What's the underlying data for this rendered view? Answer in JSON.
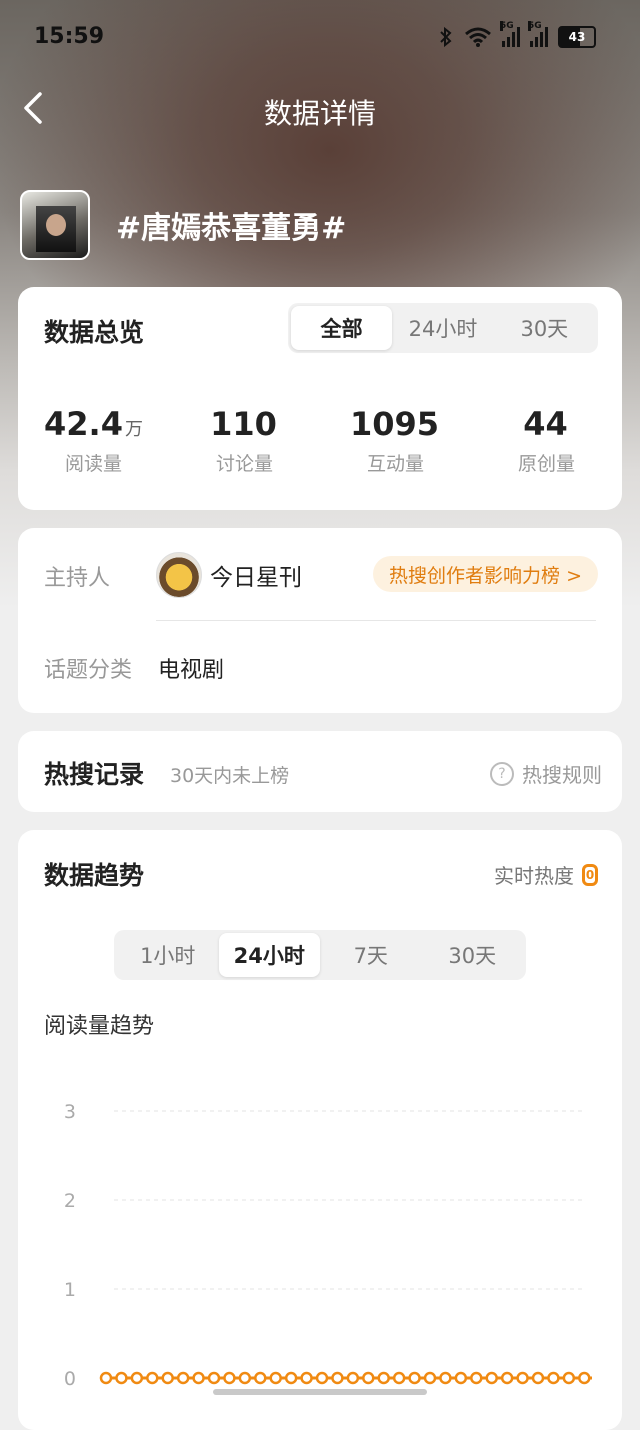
{
  "status": {
    "time": "15:59",
    "net1": "5G",
    "net2": "5G",
    "battery": "43"
  },
  "nav": {
    "title": "数据详情"
  },
  "topic": {
    "title": "#唐嫣恭喜董勇#"
  },
  "overview": {
    "title": "数据总览",
    "ranges": [
      "全部",
      "24小时",
      "30天"
    ],
    "selected_range": "全部",
    "stats": [
      {
        "value": "42.4",
        "unit": "万",
        "label": "阅读量"
      },
      {
        "value": "110",
        "unit": "",
        "label": "讨论量"
      },
      {
        "value": "1095",
        "unit": "",
        "label": "互动量"
      },
      {
        "value": "44",
        "unit": "",
        "label": "原创量"
      }
    ]
  },
  "info": {
    "host_label": "主持人",
    "host_name": "今日星刊",
    "rank_link": "热搜创作者影响力榜 >",
    "category_label": "话题分类",
    "category_value": "电视剧"
  },
  "hot": {
    "title": "热搜记录",
    "subtitle": "30天内未上榜",
    "rule": "热搜规则",
    "rule_icon": "question-icon"
  },
  "trend": {
    "title": "数据趋势",
    "realtime_label": "实时热度",
    "realtime_value": "0",
    "ranges": [
      "1小时",
      "24小时",
      "7天",
      "30天"
    ],
    "selected_range": "24小时",
    "chart_title": "阅读量趋势"
  },
  "colors": {
    "accent": "#f08a12",
    "pill_bg": "#fdf1df"
  },
  "chart_data": {
    "type": "line",
    "title": "阅读量趋势",
    "xlabel": "",
    "ylabel": "",
    "ylim": [
      0,
      3
    ],
    "yticks": [
      "3",
      "2",
      "1",
      "0"
    ],
    "grid": true,
    "series": [
      {
        "values": [
          0,
          0,
          0,
          0,
          0,
          0,
          0,
          0,
          0,
          0,
          0,
          0,
          0,
          0,
          0,
          0,
          0,
          0,
          0,
          0,
          0,
          0,
          0,
          0,
          0,
          0,
          0,
          0,
          0,
          0,
          0,
          0,
          0,
          0,
          0,
          0,
          0,
          0,
          0,
          0,
          0,
          0,
          0,
          0,
          0,
          0,
          0,
          0,
          0,
          0,
          0,
          0,
          0,
          0,
          0,
          0,
          0,
          0,
          0,
          0,
          0,
          0,
          0,
          0
        ]
      }
    ]
  }
}
